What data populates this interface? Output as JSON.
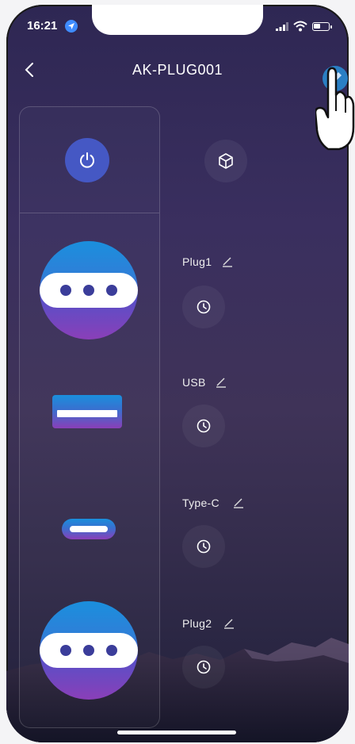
{
  "status": {
    "time": "16:21"
  },
  "header": {
    "title": "AK-PLUG001"
  },
  "outlets": [
    {
      "label": "Plug1"
    },
    {
      "label": "USB"
    },
    {
      "label": "Type-C"
    },
    {
      "label": "Plug2"
    }
  ],
  "icons": {
    "back": "chevron-left-icon",
    "edit": "pencil-icon",
    "power": "power-icon",
    "cube": "cube-icon",
    "timer": "clock-icon"
  },
  "colors": {
    "accent": "#4558c4",
    "bg_top": "#2e2753",
    "bg_bottom": "#20203a"
  }
}
